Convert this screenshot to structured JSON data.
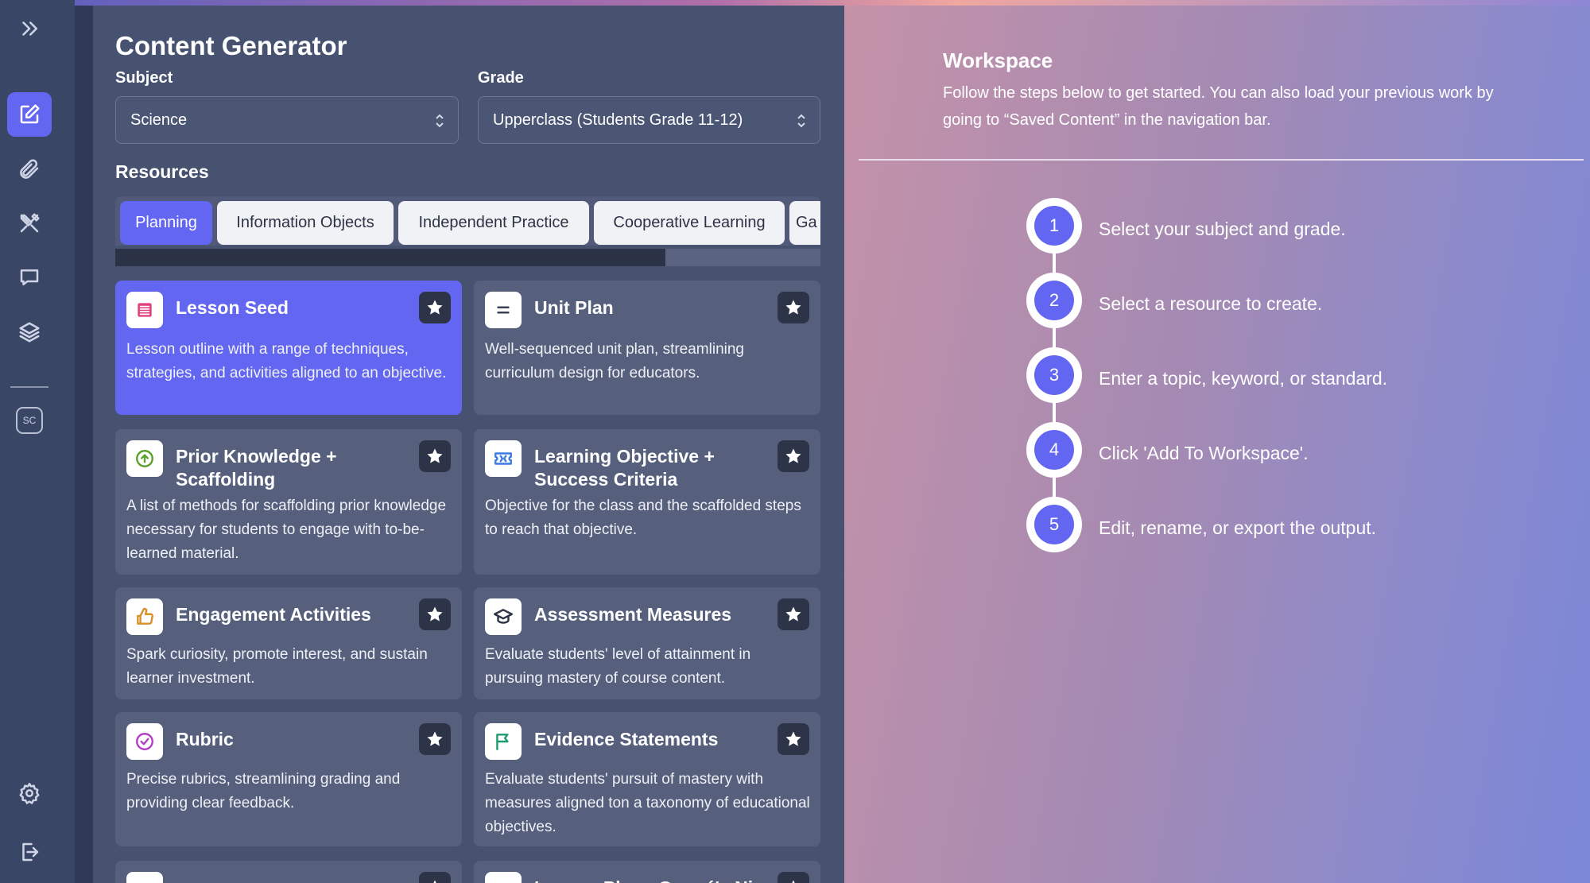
{
  "sidebar": {
    "items": [
      {
        "icon": "double-chevron-right-icon"
      },
      {
        "icon": "edit-icon",
        "active": true
      },
      {
        "icon": "paperclip-icon"
      },
      {
        "icon": "tools-icon"
      },
      {
        "icon": "chat-icon"
      },
      {
        "icon": "layers-icon"
      }
    ],
    "avatar_initials": "SC",
    "bottom_items": [
      {
        "icon": "gear-icon"
      },
      {
        "icon": "logout-icon"
      }
    ]
  },
  "generator": {
    "title": "Content Generator",
    "subject_label": "Subject",
    "subject_value": "Science",
    "grade_label": "Grade",
    "grade_value": "Upperclass (Students Grade 11-12)",
    "resources_label": "Resources",
    "tabs": [
      {
        "label": "Planning",
        "active": true
      },
      {
        "label": "Information Objects"
      },
      {
        "label": "Independent Practice"
      },
      {
        "label": "Cooperative Learning"
      },
      {
        "label": "Ga"
      }
    ],
    "tab_scroll_fraction": 0.78,
    "cards": [
      {
        "title": "Lesson Seed",
        "desc": "Lesson outline with a range of techniques, strategies, and activities aligned to an objective.",
        "icon": "lines-icon",
        "icon_color": "#e0407b",
        "selected": true
      },
      {
        "title": "Unit Plan",
        "desc": "Well-sequenced unit plan, streamlining curriculum design for educators.",
        "icon": "equals-icon",
        "icon_color": "#3b4254"
      },
      {
        "title": "Prior Knowledge + Scaffolding",
        "desc": "A list of methods for scaffolding prior knowledge necessary for students to engage with to-be-learned material.",
        "icon": "arrow-up-circle-icon",
        "icon_color": "#5aa02c"
      },
      {
        "title": "Learning Objective + Success Criteria",
        "desc": "Objective for the class and the scaffolded steps to reach that objective.",
        "icon": "ticket-icon",
        "icon_color": "#3d7be0"
      },
      {
        "title": "Engagement Activities",
        "desc": "Spark curiosity, promote interest, and sustain learner investment.",
        "icon": "thumbs-up-icon",
        "icon_color": "#d7902a"
      },
      {
        "title": "Assessment Measures",
        "desc": "Evaluate students' level of attainment in pursuing mastery of course content.",
        "icon": "graduation-cap-icon",
        "icon_color": "#2c3345"
      },
      {
        "title": "Rubric",
        "desc": "Precise rubrics, streamlining grading and providing clear feedback.",
        "icon": "check-circle-icon",
        "icon_color": "#b13fc4"
      },
      {
        "title": "Evidence Statements",
        "desc": "Evaluate students' pursuit of mastery with measures aligned ton a taxonomy of educational objectives.",
        "icon": "flag-icon",
        "icon_color": "#1e9a6f"
      },
      {
        "title": "",
        "desc": "",
        "icon": "partial-icon",
        "icon_color": "#5aa02c"
      },
      {
        "title": "Lesson Plan - Gagné's Nine",
        "desc": "",
        "icon": "partial-icon",
        "icon_color": "#e0407b"
      }
    ]
  },
  "workspace": {
    "title": "Workspace",
    "description": "Follow the steps below to get started. You can also load your previous work by going to “Saved Content” in the navigation bar.",
    "steps": [
      {
        "number": "1",
        "text": "Select your subject and grade."
      },
      {
        "number": "2",
        "text": "Select a resource to create."
      },
      {
        "number": "3",
        "text": "Enter a topic, keyword, or standard."
      },
      {
        "number": "4",
        "text": "Click 'Add To Workspace'."
      },
      {
        "number": "5",
        "text": "Edit, rename, or export the output."
      }
    ]
  }
}
